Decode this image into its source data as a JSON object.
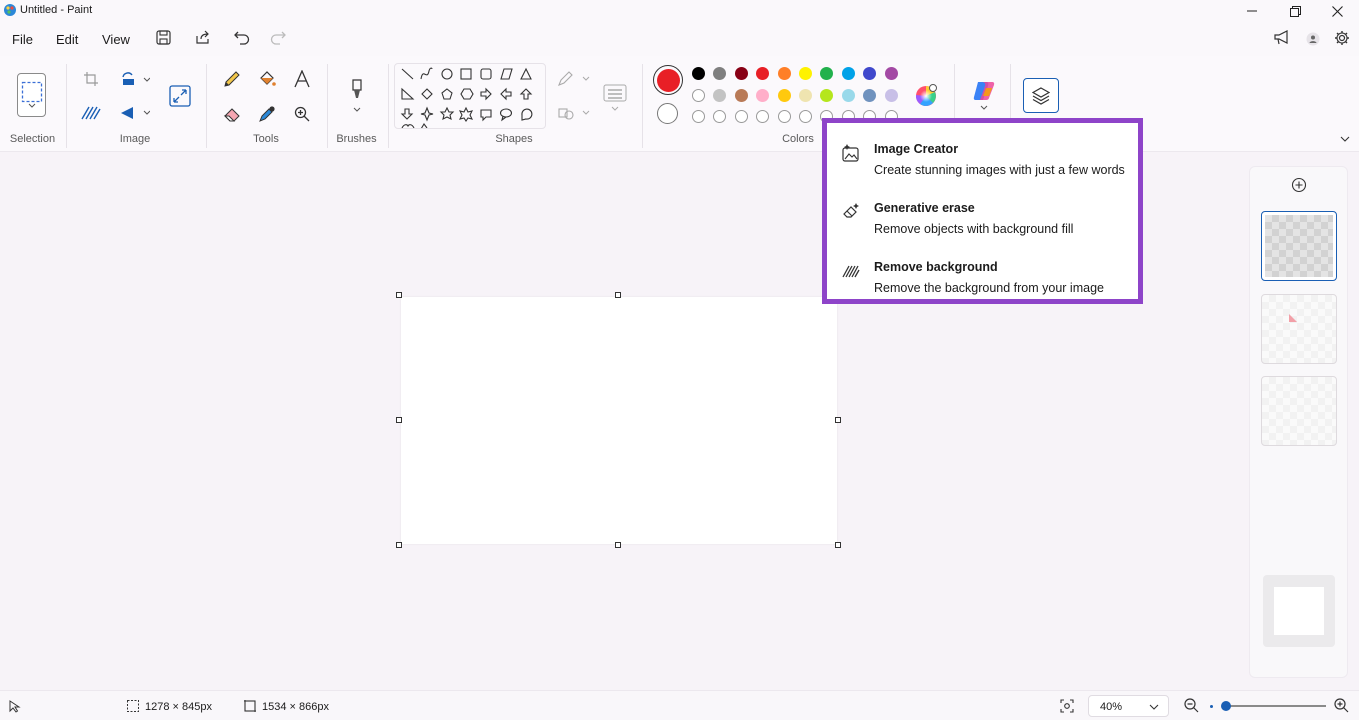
{
  "window": {
    "title": "Untitled - Paint"
  },
  "menu": {
    "file": "File",
    "edit": "Edit",
    "view": "View"
  },
  "ribbon": {
    "groups": {
      "selection": "Selection",
      "image": "Image",
      "tools": "Tools",
      "brushes": "Brushes",
      "shapes": "Shapes",
      "colors": "Colors"
    },
    "active_color": "#e81f26",
    "palette_row1": [
      "#000000",
      "#7f7f7f",
      "#880015",
      "#e81f26",
      "#ff7f27",
      "#fff200",
      "#22b14c",
      "#00a2e8",
      "#3f48cc",
      "#a349a4"
    ],
    "palette_row2": [
      "#ffffff",
      "#c3c3c3",
      "#b97a57",
      "#ffaec9",
      "#ffc90e",
      "#efe4b0",
      "#b5e61d",
      "#99d9ea",
      "#7092be",
      "#c8bfe7"
    ]
  },
  "copilot_menu": {
    "border_color": "#8e44c9",
    "items": [
      {
        "title": "Image Creator",
        "description": "Create stunning images with just a few words",
        "icon": "image-creator-icon"
      },
      {
        "title": "Generative erase",
        "description": "Remove objects with background fill",
        "icon": "generative-erase-icon"
      },
      {
        "title": "Remove background",
        "description": "Remove the background from your image",
        "icon": "remove-background-icon"
      }
    ]
  },
  "status": {
    "selection_size": "1278 × 845px",
    "canvas_size": "1534 × 866px",
    "zoom": "40%",
    "zoom_slider_fraction": 0.05
  }
}
